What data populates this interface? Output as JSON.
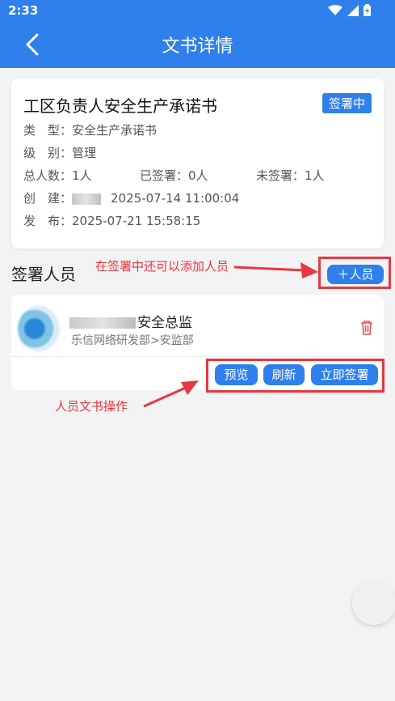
{
  "status_bar": {
    "time": "2:33",
    "icons": [
      "wifi-icon",
      "signal-icon",
      "battery-icon"
    ]
  },
  "header": {
    "title": "文书详情",
    "back_icon": "back-chevron-icon"
  },
  "document": {
    "title": "工区负责人安全生产承诺书",
    "status": "签署中",
    "type_label": "类　型：",
    "type_value": "安全生产承诺书",
    "level_label": "级　别：",
    "level_value": "管理",
    "total_label": "总人数：",
    "total_value": "1人",
    "signed_label": "已签署：",
    "signed_value": "0人",
    "unsigned_label": "未签署：",
    "unsigned_value": "1人",
    "created_label": "创　建：",
    "created_time": "2025-07-14 11:00:04",
    "published_label": "发　布：",
    "published_time": "2025-07-21 15:58:15"
  },
  "signers": {
    "section_title": "签署人员",
    "add_button": "＋人员",
    "items": [
      {
        "name_suffix": "安全总监",
        "department": "乐信网络研发部>安监部",
        "actions": [
          "预览",
          "刷新",
          "立即签署"
        ]
      }
    ]
  },
  "annotations": {
    "add_hint": "在签署中还可以添加人员",
    "ops_hint": "人员文书操作"
  },
  "colors": {
    "primary": "#2f80ed",
    "annotation_red": "#e8373f",
    "delete_red": "#e8505b"
  }
}
